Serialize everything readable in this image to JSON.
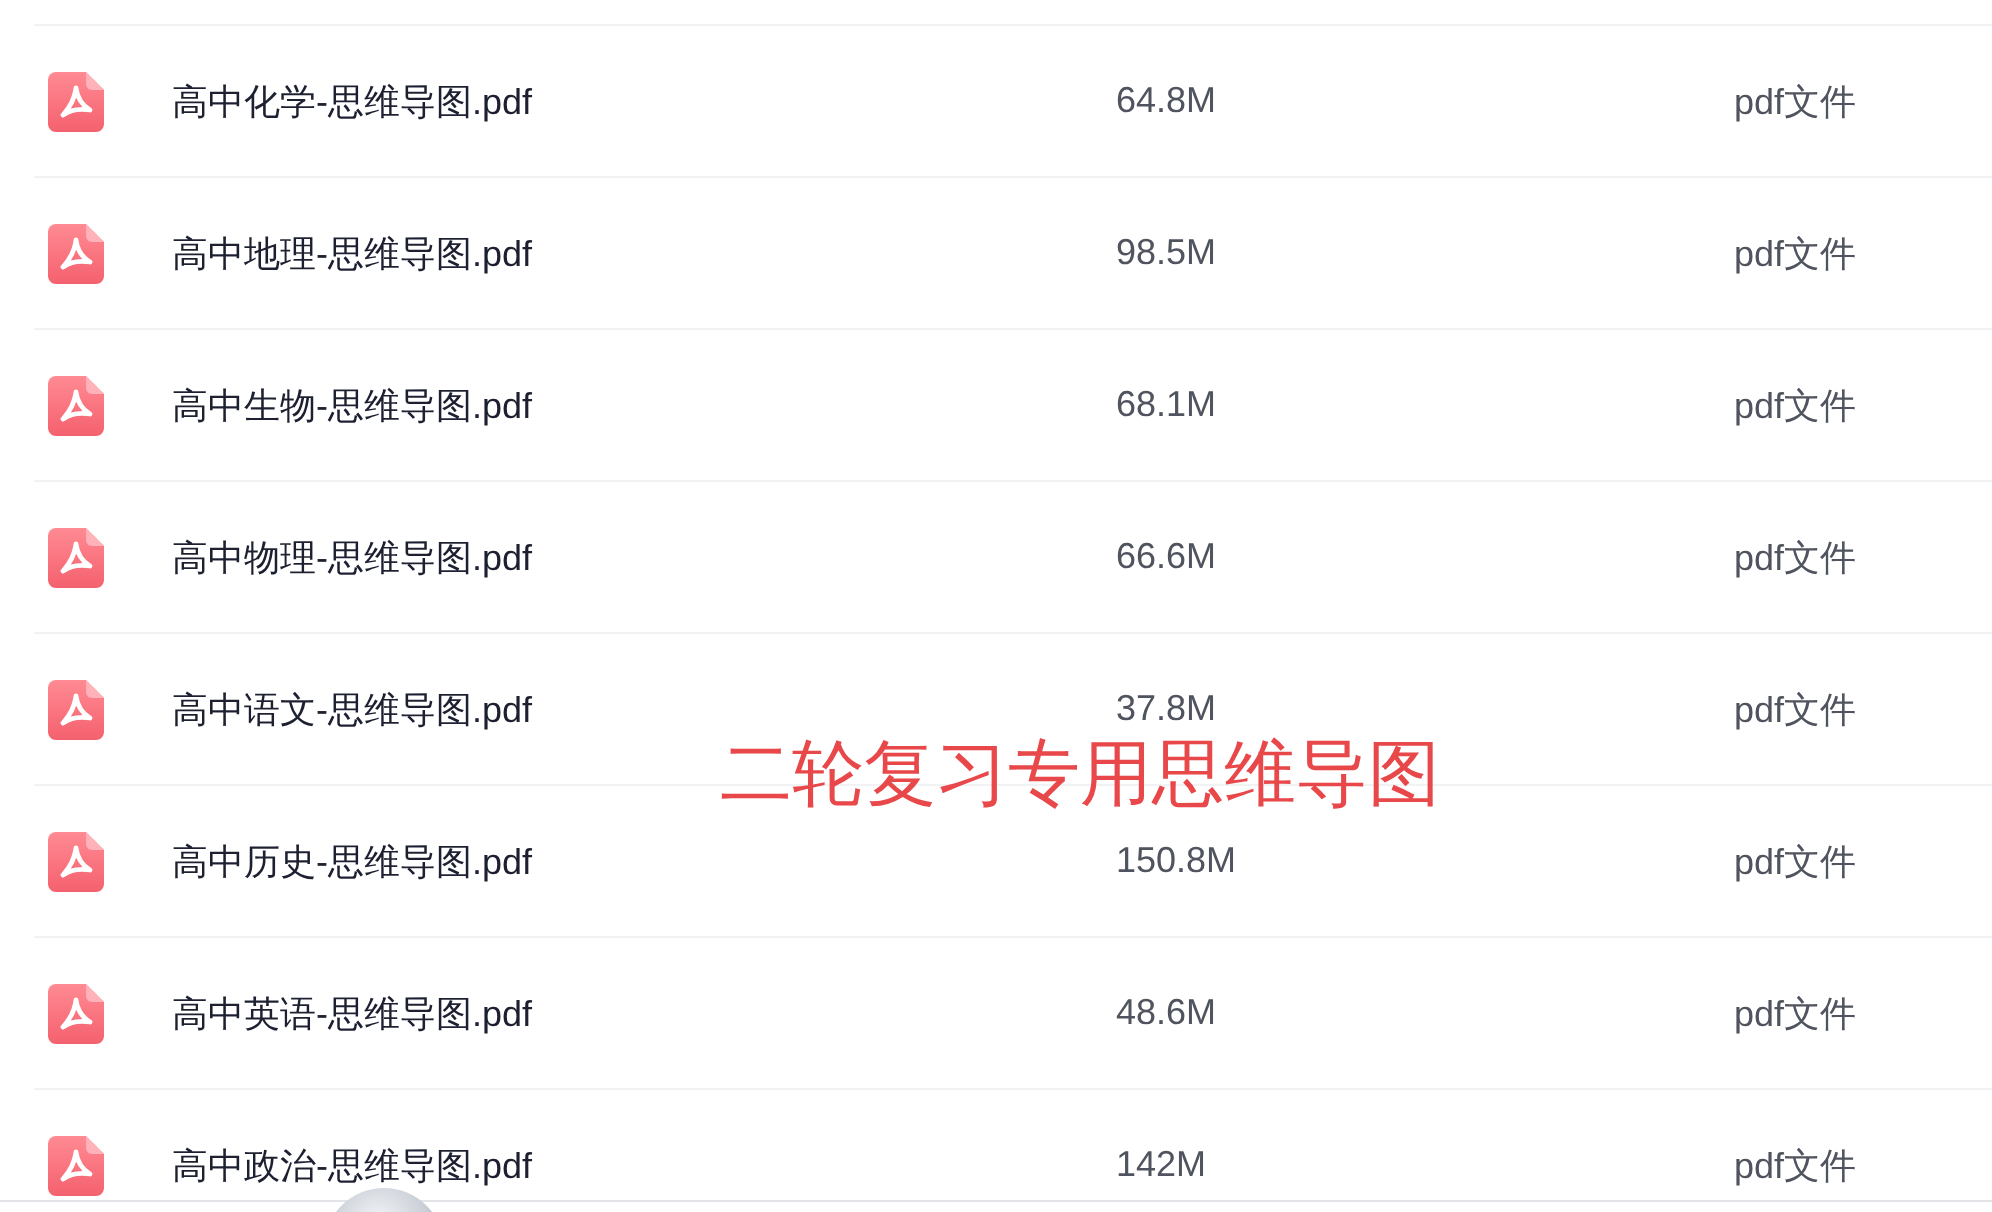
{
  "files": [
    {
      "kind": "pdf",
      "name": "高中化学-思维导图.pdf",
      "size": "64.8M",
      "type": "pdf文件"
    },
    {
      "kind": "pdf",
      "name": "高中地理-思维导图.pdf",
      "size": "98.5M",
      "type": "pdf文件"
    },
    {
      "kind": "pdf",
      "name": "高中生物-思维导图.pdf",
      "size": "68.1M",
      "type": "pdf文件"
    },
    {
      "kind": "pdf",
      "name": "高中物理-思维导图.pdf",
      "size": "66.6M",
      "type": "pdf文件"
    },
    {
      "kind": "pdf",
      "name": "高中语文-思维导图.pdf",
      "size": "37.8M",
      "type": "pdf文件"
    },
    {
      "kind": "pdf",
      "name": "高中历史-思维导图.pdf",
      "size": "150.8M",
      "type": "pdf文件"
    },
    {
      "kind": "pdf",
      "name": "高中英语-思维导图.pdf",
      "size": "48.6M",
      "type": "pdf文件"
    },
    {
      "kind": "pdf",
      "name": "高中政治-思维导图.pdf",
      "size": "142M",
      "type": "pdf文件"
    }
  ],
  "overlay_caption": "二轮复习专用思维导图"
}
